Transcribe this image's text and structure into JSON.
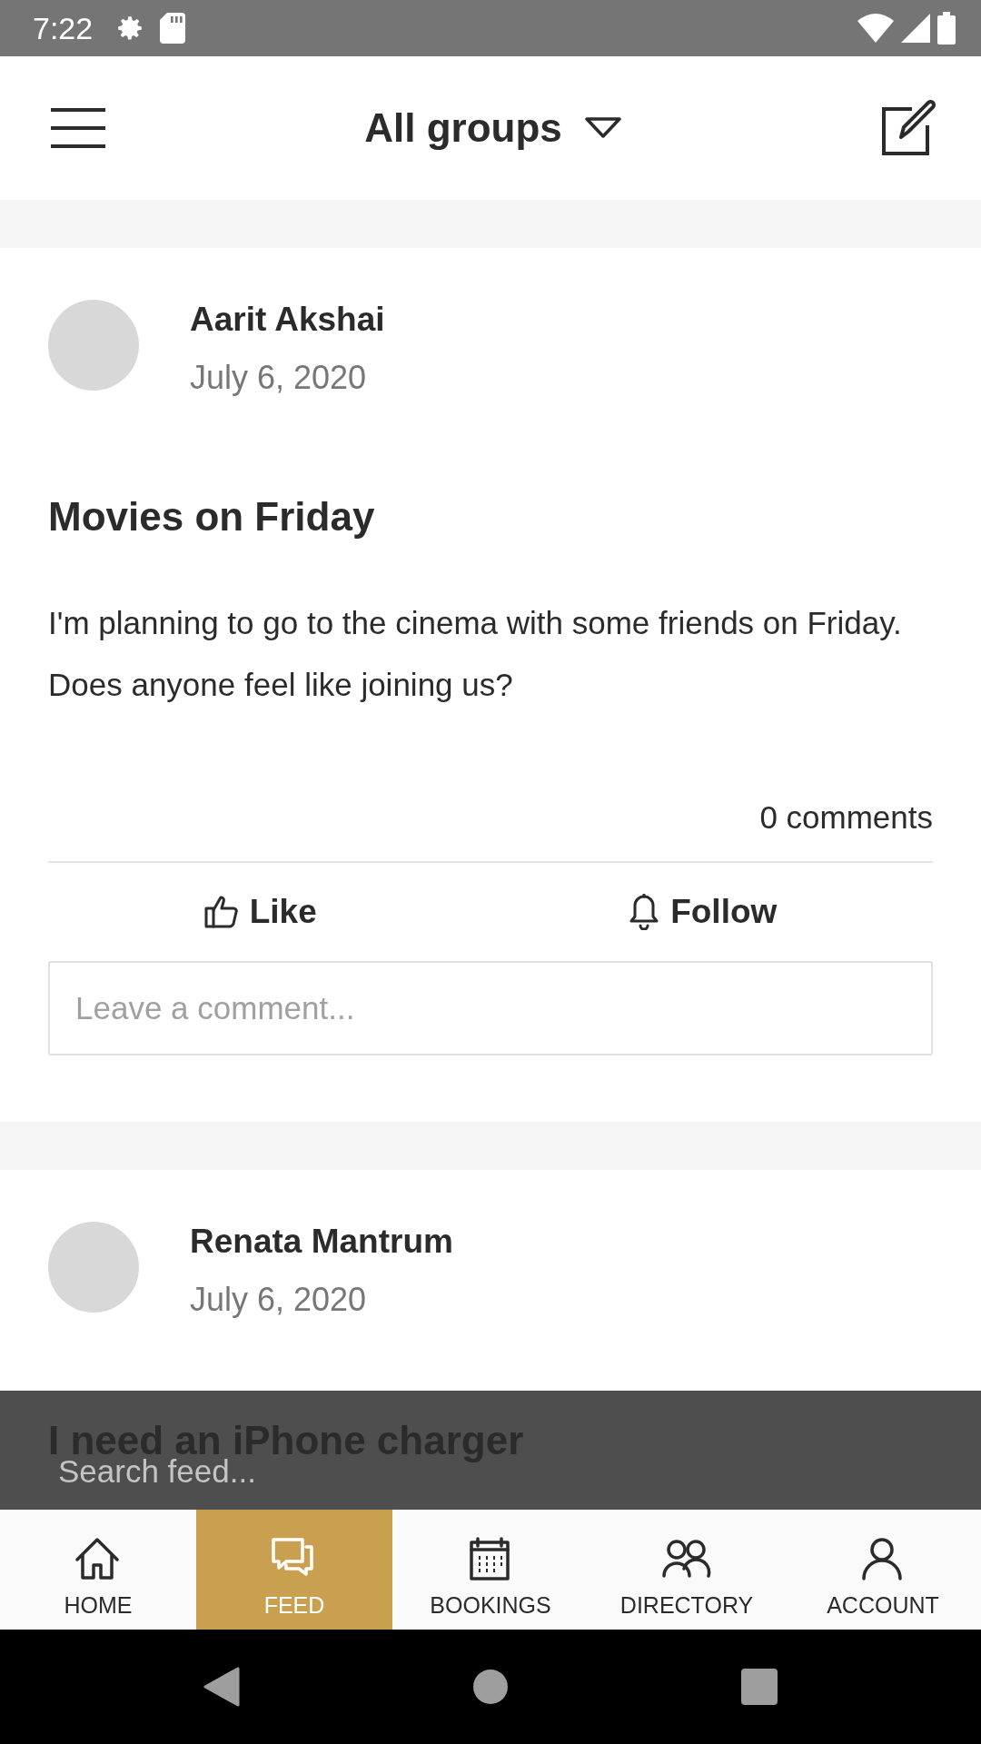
{
  "status_bar": {
    "time": "7:22"
  },
  "header": {
    "title": "All groups"
  },
  "posts": [
    {
      "author": "Aarit Akshai",
      "date": "July 6, 2020",
      "title": "Movies on Friday",
      "body": "I'm planning to go to the cinema with some friends on Friday. Does anyone feel like joining us?",
      "comments": "0 comments",
      "actions": [
        {
          "kind": "like",
          "label": "Like"
        },
        {
          "kind": "follow",
          "label": "Follow"
        }
      ],
      "comment_field": {
        "placeholder": "Leave a comment..."
      }
    },
    {
      "author": "Renata Mantrum",
      "date": "July 6, 2020",
      "title": "I need an iPhone charger"
    }
  ],
  "search": {
    "placeholder": "Search feed..."
  },
  "nav": [
    {
      "kind": "home",
      "label": "HOME",
      "selected": false
    },
    {
      "kind": "feed",
      "label": "FEED",
      "selected": true
    },
    {
      "kind": "bookings",
      "label": "BOOKINGS",
      "selected": false
    },
    {
      "kind": "directory",
      "label": "DIRECTORY",
      "selected": false
    },
    {
      "kind": "account",
      "label": "ACCOUNT",
      "selected": false
    }
  ]
}
